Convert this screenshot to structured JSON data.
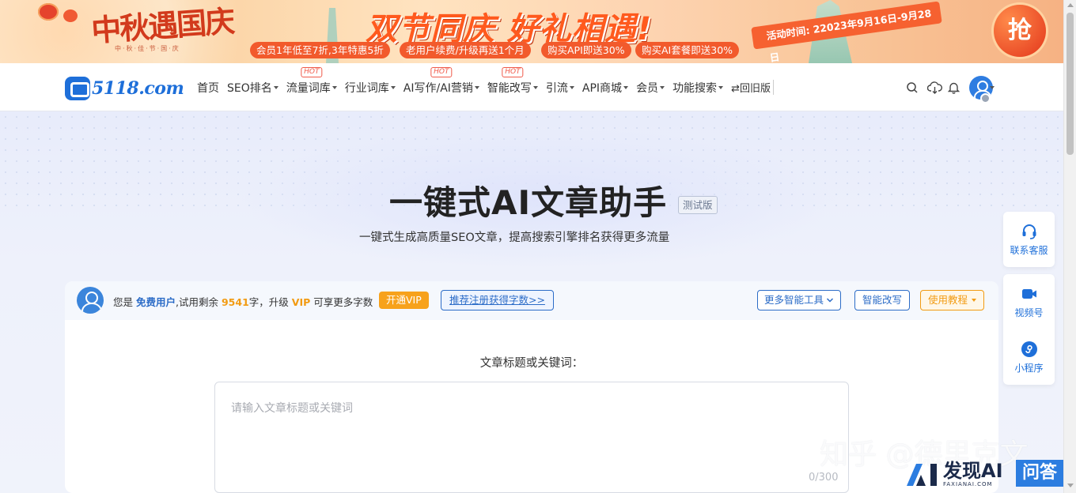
{
  "banner": {
    "festival_logo": "中秋遇国庆",
    "festival_logo_sub": "中·秋·佳·节·国·庆",
    "title": "双节同庆 好礼相遇!",
    "offers": [
      "会员1年低至7折,3年特惠5折",
      "老用户续费/升级再送1个月",
      "购买API即送30%",
      "购买AI套餐即送30%"
    ],
    "date": "活动时间: 22023年9月16日-9月28日",
    "grab_label": "抢"
  },
  "nav": {
    "logo_text": "5118.com",
    "items": [
      {
        "label": "首页",
        "dropdown": false,
        "hot": false
      },
      {
        "label": "SEO排名",
        "dropdown": true,
        "hot": false
      },
      {
        "label": "流量词库",
        "dropdown": true,
        "hot": true
      },
      {
        "label": "行业词库",
        "dropdown": true,
        "hot": false
      },
      {
        "label": "AI写作/AI营销",
        "dropdown": true,
        "hot": true
      },
      {
        "label": "智能改写",
        "dropdown": true,
        "hot": true
      },
      {
        "label": "引流",
        "dropdown": true,
        "hot": false
      },
      {
        "label": "API商城",
        "dropdown": true,
        "hot": false
      },
      {
        "label": "会员",
        "dropdown": true,
        "hot": false
      },
      {
        "label": "功能搜索",
        "dropdown": true,
        "hot": false
      }
    ],
    "hot_label": "HOT",
    "old_version": "⇄回旧版",
    "icons": [
      "search-icon",
      "cloud-download-icon",
      "bell-icon",
      "user-avatar"
    ]
  },
  "hero": {
    "title": "一键式AI文章助手",
    "beta": "测试版",
    "subtitle": "一键式生成高质量SEO文章，提高搜索引擎排名获得更多流量"
  },
  "card": {
    "quota_prefix": "您是",
    "user_type": "免费用户",
    "quota_mid": ",试用剩余",
    "remaining": "9541",
    "quota_unit": "字，升级",
    "vip": "VIP",
    "quota_suffix": "可享更多字数",
    "open_vip": "开通VIP",
    "register_link": "推荐注册获得字数>>",
    "more_tools": "更多智能工具",
    "rewrite": "智能改写",
    "tutorial": "使用教程",
    "field_label": "文章标题或关键词：",
    "placeholder": "请输入文章标题或关键词",
    "counter": "0/300"
  },
  "sidebar": {
    "support": "联系客服",
    "video": "视频号",
    "mini_program": "小程序"
  },
  "watermark": {
    "text": "知乎 @德里克文",
    "fx_main": "发现AI",
    "fx_sub": "FAXIANAI.COM",
    "fx_ask": "问答"
  },
  "colors": {
    "brand_blue": "#1e6fd9",
    "accent_orange": "#f29b12",
    "hot_red": "#f05a4a",
    "banner_red": "#f25a2c"
  }
}
